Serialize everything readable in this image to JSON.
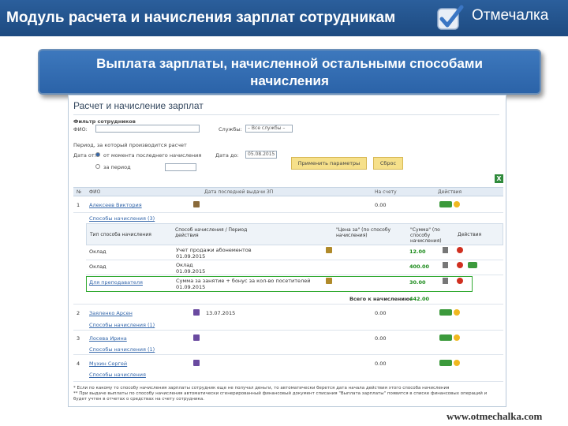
{
  "header": {
    "title": "Модуль расчета и начисления зарплат сотрудникам",
    "brand": "Отмечалка"
  },
  "banner": {
    "line1": "Выплата зарплаты, начисленной остальными способами",
    "line2": "начисления"
  },
  "screen": {
    "page_title": "Расчет и начисление зарплат",
    "filter": {
      "section_label": "Фильтр сотрудников",
      "name_label": "ФИО:",
      "name_value": "",
      "position_label": "Службы:",
      "position_value": "– Все службы –",
      "period_label": "Период, за который производится расчет",
      "pay_from_label": "Дата от:",
      "radio_last_label": "от момента последнего начисления",
      "radio_custom_label": "за период",
      "date_to_label": "Дата до:",
      "date_to_value": "05.08.2015",
      "apply_button": "Применить параметры",
      "reset_button": "Сброс"
    },
    "table": {
      "columns": [
        "№",
        "ФИО",
        "Дата последней выдачи ЗП",
        "На счету",
        "Действия"
      ],
      "rows": [
        {
          "num": "1",
          "name": "Алексеев Виктория",
          "last_pay": "",
          "balance": "0.00",
          "methods_label": "Способы начисления (3)",
          "methods": {
            "columns": [
              "Тип способа начисления",
              "Способ начисления / Период действия",
              "\"Цена за\" (по способу начисления)",
              "\"Сумма\" (по способу начисления)",
              "Действия"
            ],
            "rows": [
              {
                "type": "Оклад",
                "method": "Учет продажи абонементов",
                "period": "01.09.2015",
                "amount": "12.00"
              },
              {
                "type": "Оклад",
                "method": "Оклад",
                "period": "01.09.2015",
                "amount": "400.00"
              },
              {
                "type": "Для преподавателя",
                "method": "Сумма за занятие + бонус за кол-во посетителей",
                "period": "01.09.2015",
                "amount": "30.00"
              }
            ],
            "total_label": "Всего к начислению:",
            "total_value": "442.00"
          }
        },
        {
          "num": "2",
          "name": "Заяленко Арсен",
          "last_pay": "13.07.2015",
          "balance": "0.00",
          "methods_label": "Способы начисления (1)"
        },
        {
          "num": "3",
          "name": "Лосева Ирина",
          "last_pay": "",
          "balance": "0.00",
          "methods_label": "Способы начисления (1)"
        },
        {
          "num": "4",
          "name": "Мухин Сергей",
          "last_pay": "",
          "balance": "0.00",
          "methods_label": "Способы начисления"
        }
      ]
    },
    "footnote1": "* Если по какому то способу начисления зарплаты сотрудник еще не получал деньги, то автоматически берется дата начала действия этого способа начисления",
    "footnote2": "** При выдаче выплаты по способу начисления автоматически сгенерированный финансовый документ списания \"Выплата зарплаты\" появится в списке финансовых операций и будет учтен в отчетах о средствах на счету сотрудника."
  },
  "footer_url": "www.otmechalka.com",
  "colors": {
    "header_bg": "#1d4a80",
    "banner_bg": "#2b63a8",
    "button_bg": "#f6e08a",
    "accent_green": "#3c9a3c",
    "link": "#3366aa"
  },
  "icons": [
    "checkmark-logo-icon",
    "excel-export-icon",
    "details-icon",
    "pay-button-icon",
    "smile-icon",
    "calendar-icon",
    "delete-icon"
  ]
}
